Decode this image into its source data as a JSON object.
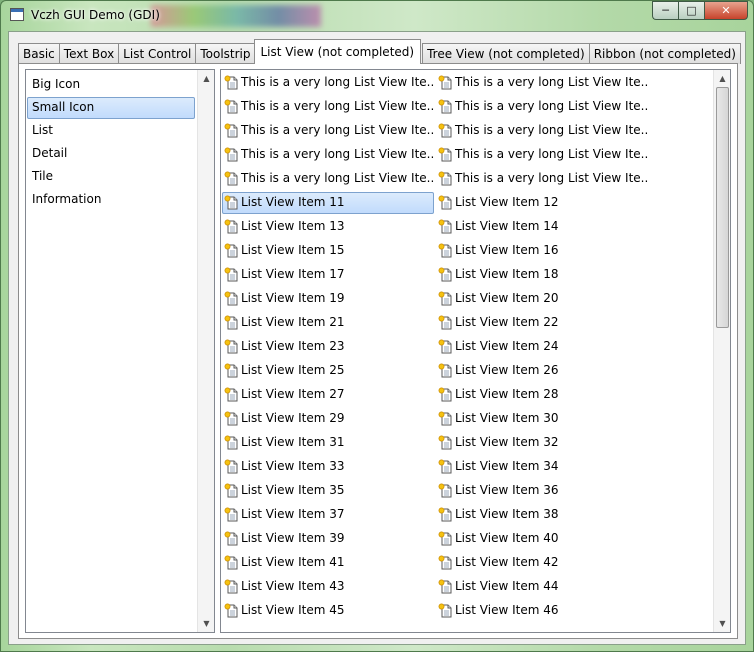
{
  "window": {
    "title": "Vczh GUI Demo (GDI)",
    "controls": {
      "minimize": "─",
      "maximize": "□",
      "close": "✕"
    }
  },
  "tabs": [
    {
      "label": "Basic"
    },
    {
      "label": "Text Box"
    },
    {
      "label": "List Control"
    },
    {
      "label": "Toolstrip"
    },
    {
      "label": "List View (not completed)",
      "active": true
    },
    {
      "label": "Tree View (not completed)"
    },
    {
      "label": "Ribbon (not completed)"
    }
  ],
  "views": {
    "items": [
      "Big Icon",
      "Small Icon",
      "List",
      "Detail",
      "Tile",
      "Information"
    ],
    "selected": "Small Icon"
  },
  "listview": {
    "long_item_text": "This is a very long List View Ite...",
    "selected": "List View Item 11",
    "items": [
      "This is a very long List View Ite...",
      "This is a very long List View Ite...",
      "This is a very long List View Ite...",
      "This is a very long List View Ite...",
      "This is a very long List View Ite...",
      "This is a very long List View Ite...",
      "This is a very long List View Ite...",
      "This is a very long List View Ite...",
      "This is a very long List View Ite...",
      "This is a very long List View Ite...",
      "List View Item 11",
      "List View Item 12",
      "List View Item 13",
      "List View Item 14",
      "List View Item 15",
      "List View Item 16",
      "List View Item 17",
      "List View Item 18",
      "List View Item 19",
      "List View Item 20",
      "List View Item 21",
      "List View Item 22",
      "List View Item 23",
      "List View Item 24",
      "List View Item 25",
      "List View Item 26",
      "List View Item 27",
      "List View Item 28",
      "List View Item 29",
      "List View Item 30",
      "List View Item 31",
      "List View Item 32",
      "List View Item 33",
      "List View Item 34",
      "List View Item 35",
      "List View Item 36",
      "List View Item 37",
      "List View Item 38",
      "List View Item 39",
      "List View Item 40",
      "List View Item 41",
      "List View Item 42",
      "List View Item 43",
      "List View Item 44",
      "List View Item 45",
      "List View Item 46"
    ],
    "item_icon": "document-icon",
    "scroll_position": 0
  },
  "colors": {
    "selection_fill": "#c1dbfc",
    "selection_border": "#7da2ce",
    "window_frame": "#b8dcae"
  }
}
